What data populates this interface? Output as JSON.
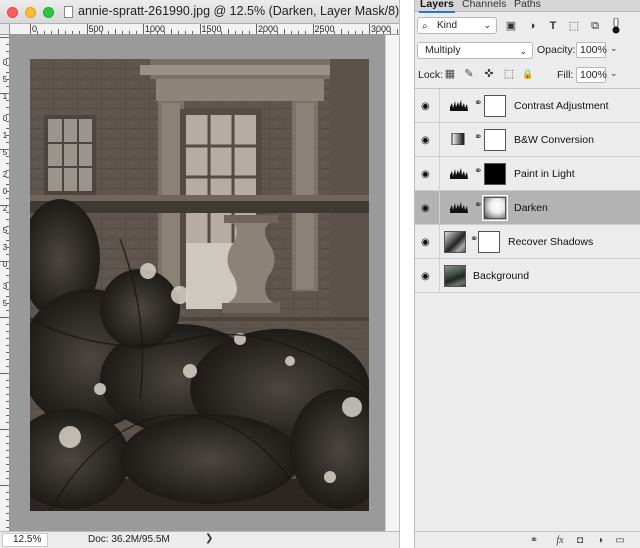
{
  "document": {
    "title": "annie-spratt-261990.jpg @ 12.5% (Darken, Layer Mask/8) *",
    "ruler_h_labels": [
      "0",
      "500",
      "1000",
      "1500",
      "2000",
      "2500",
      "3000"
    ],
    "ruler_v_labels": [
      "0",
      "5",
      "1",
      "0",
      "1",
      "5",
      "2",
      "0",
      "2",
      "5",
      "3",
      "0",
      "3",
      "5"
    ],
    "zoom": "12.5%",
    "doc_info": "Doc: 36.2M/95.5M",
    "status_arrow": "❯"
  },
  "panel": {
    "tabs": [
      {
        "label": "Layers",
        "active": true
      },
      {
        "label": "Channels",
        "active": false
      },
      {
        "label": "Paths",
        "active": false
      }
    ],
    "filter": {
      "search_glyph": "⌕",
      "kind_label": "Kind",
      "chevron": "⌄",
      "icons": [
        {
          "name": "pixel-filter-icon",
          "glyph": "▣"
        },
        {
          "name": "adjustment-filter-icon",
          "glyph": "◑"
        },
        {
          "name": "type-filter-icon",
          "glyph": "T"
        },
        {
          "name": "shape-filter-icon",
          "glyph": "⬚"
        },
        {
          "name": "smart-object-filter-icon",
          "glyph": "⧉"
        }
      ]
    },
    "blend_mode": "Multiply",
    "opacity_label": "Opacity:",
    "opacity_value": "100%",
    "lock_label": "Lock:",
    "lock_icons": [
      {
        "name": "lock-transparent-icon",
        "glyph": "▦"
      },
      {
        "name": "lock-paint-icon",
        "glyph": "✎"
      },
      {
        "name": "lock-position-icon",
        "glyph": "✜"
      },
      {
        "name": "lock-artboard-icon",
        "glyph": "⬚"
      },
      {
        "name": "lock-all-icon",
        "glyph": "🔒"
      }
    ],
    "fill_label": "Fill:",
    "fill_value": "100%",
    "dropdown_chevron": "⌄",
    "layers": [
      {
        "name": "Contrast Adjustment",
        "type": "levels",
        "mask": "white",
        "selected": false
      },
      {
        "name": "B&W Conversion",
        "type": "bw",
        "mask": "white",
        "selected": false
      },
      {
        "name": "Paint in Light",
        "type": "levels",
        "mask": "black",
        "selected": false
      },
      {
        "name": "Darken",
        "type": "levels",
        "mask": "gradient",
        "selected": true
      },
      {
        "name": "Recover Shadows",
        "type": "image",
        "mask": "white",
        "selected": false
      },
      {
        "name": "Background",
        "type": "image",
        "mask": "none",
        "selected": false
      }
    ],
    "eye_glyph": "◉",
    "chain_glyph": "⚭",
    "footer_icons": [
      {
        "name": "link-layers-icon",
        "glyph": "⚭"
      },
      {
        "name": "layer-style-icon",
        "glyph": "fx"
      },
      {
        "name": "add-mask-icon",
        "glyph": "◘"
      },
      {
        "name": "new-adjustment-icon",
        "glyph": "◑"
      },
      {
        "name": "new-group-icon",
        "glyph": "▭"
      }
    ]
  }
}
